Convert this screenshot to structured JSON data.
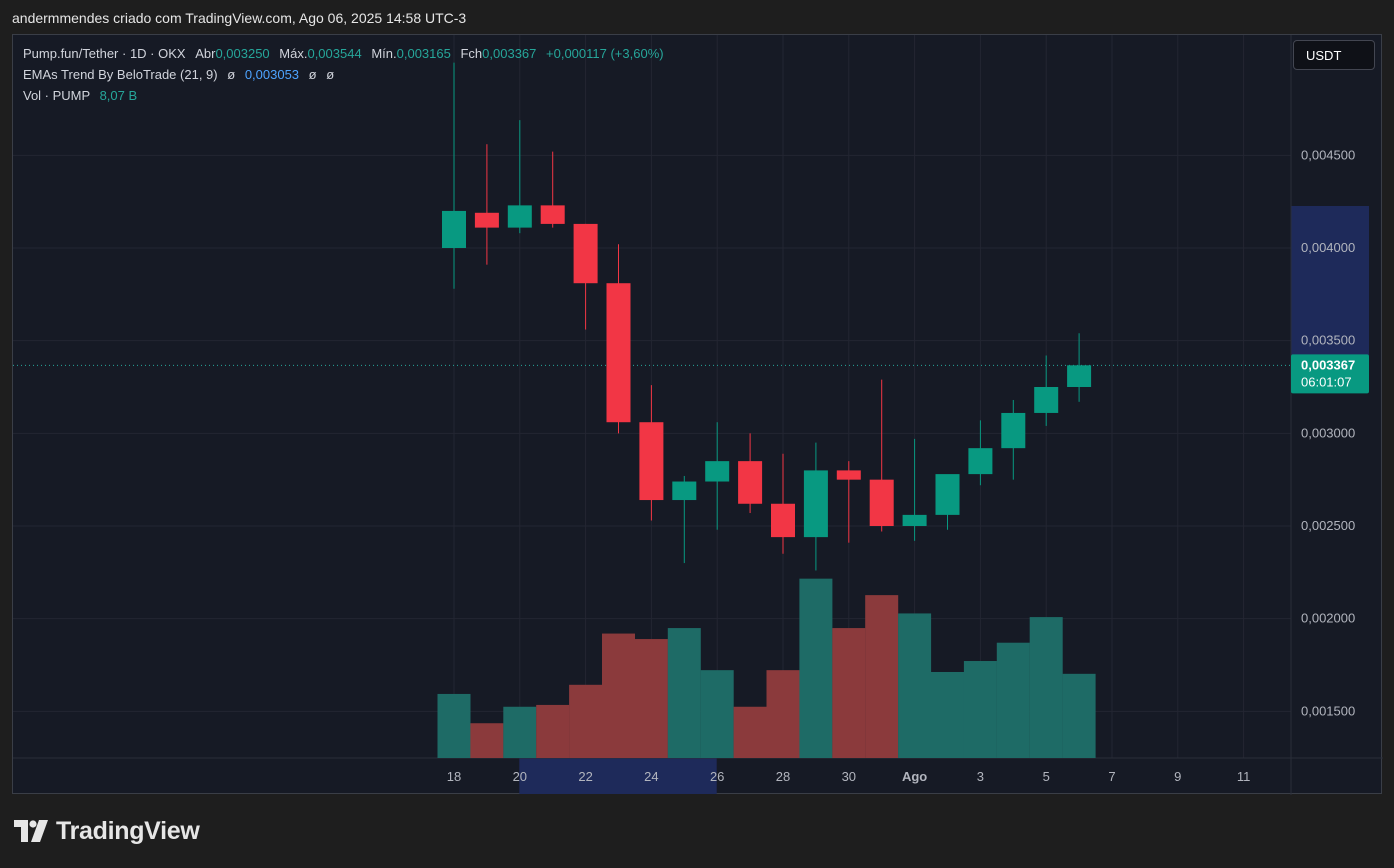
{
  "header": {
    "text": "andermmendes criado com TradingView.com, Ago 06, 2025 14:58 UTC-3"
  },
  "legend": {
    "line1": {
      "symbol": "Pump.fun/Tether · 1D · OKX",
      "o_label": "Abr",
      "o": "0,003250",
      "h_label": "Máx.",
      "h": "0,003544",
      "l_label": "Mín.",
      "l": "0,003165",
      "c_label": "Fch",
      "c": "0,003367",
      "change": "+0,000117 (+3,60%)"
    },
    "line2": {
      "name": "EMAs Trend By BeloTrade (21, 9)",
      "v1": "ø",
      "v2": "0,003053",
      "v3": "ø",
      "v4": "ø"
    },
    "line3": {
      "name": "Vol · PUMP",
      "value": "8,07 B"
    }
  },
  "currency_button": "USDT",
  "footer": {
    "brand": "TradingView"
  },
  "colors": {
    "up": "#089981",
    "down": "#f23645",
    "vol_up": "#1e6b66",
    "vol_down": "#8b3a3c",
    "grid": "#232632",
    "bg": "#161a25",
    "highlight": "#1e2a5a"
  },
  "chart_data": {
    "type": "candlestick",
    "price_axis": {
      "ticks": [
        "0,004500",
        "0,004000",
        "0,003500",
        "0,003000",
        "0,002500",
        "0,002000",
        "0,001500"
      ],
      "tick_values": [
        0.0045,
        0.004,
        0.0035,
        0.003,
        0.0025,
        0.002,
        0.0015
      ]
    },
    "time_axis": {
      "ticks": [
        "18",
        "20",
        "22",
        "24",
        "26",
        "28",
        "30",
        "Ago",
        "3",
        "5",
        "7",
        "9",
        "11"
      ]
    },
    "last_price": {
      "value": "0,003367",
      "countdown": "06:01:07",
      "numeric": 0.003367
    },
    "candles": [
      {
        "date": "Jul 18",
        "o": 0.004,
        "h": 0.005,
        "l": 0.00378,
        "c": 0.0042
      },
      {
        "date": "Jul 19",
        "o": 0.00419,
        "h": 0.00456,
        "l": 0.00391,
        "c": 0.00411
      },
      {
        "date": "Jul 20",
        "o": 0.00411,
        "h": 0.00469,
        "l": 0.00408,
        "c": 0.00423
      },
      {
        "date": "Jul 21",
        "o": 0.00423,
        "h": 0.00452,
        "l": 0.00411,
        "c": 0.00413
      },
      {
        "date": "Jul 22",
        "o": 0.00413,
        "h": 0.00413,
        "l": 0.00356,
        "c": 0.00381
      },
      {
        "date": "Jul 23",
        "o": 0.00381,
        "h": 0.00402,
        "l": 0.003,
        "c": 0.00306
      },
      {
        "date": "Jul 24",
        "o": 0.00306,
        "h": 0.00326,
        "l": 0.00253,
        "c": 0.00264
      },
      {
        "date": "Jul 25",
        "o": 0.00264,
        "h": 0.00277,
        "l": 0.0023,
        "c": 0.00274
      },
      {
        "date": "Jul 26",
        "o": 0.00274,
        "h": 0.00306,
        "l": 0.00248,
        "c": 0.00285
      },
      {
        "date": "Jul 27",
        "o": 0.00285,
        "h": 0.003,
        "l": 0.00257,
        "c": 0.00262
      },
      {
        "date": "Jul 28",
        "o": 0.00262,
        "h": 0.00289,
        "l": 0.00235,
        "c": 0.00244
      },
      {
        "date": "Jul 29",
        "o": 0.00244,
        "h": 0.00295,
        "l": 0.00226,
        "c": 0.0028
      },
      {
        "date": "Jul 30",
        "o": 0.0028,
        "h": 0.00285,
        "l": 0.00241,
        "c": 0.00275
      },
      {
        "date": "Jul 31",
        "o": 0.00275,
        "h": 0.00329,
        "l": 0.00247,
        "c": 0.0025
      },
      {
        "date": "Aug 1",
        "o": 0.0025,
        "h": 0.00297,
        "l": 0.00242,
        "c": 0.00256
      },
      {
        "date": "Aug 2",
        "o": 0.00256,
        "h": 0.00277,
        "l": 0.00248,
        "c": 0.00278
      },
      {
        "date": "Aug 3",
        "o": 0.00278,
        "h": 0.00307,
        "l": 0.00272,
        "c": 0.00292
      },
      {
        "date": "Aug 4",
        "o": 0.00292,
        "h": 0.00318,
        "l": 0.00275,
        "c": 0.00311
      },
      {
        "date": "Aug 5",
        "o": 0.00311,
        "h": 0.00342,
        "l": 0.00304,
        "c": 0.00325
      },
      {
        "date": "Aug 6",
        "o": 0.00325,
        "h": 0.00354,
        "l": 0.00317,
        "c": 0.003367
      }
    ],
    "volume_relative": [
      0.35,
      0.19,
      0.28,
      0.29,
      0.4,
      0.68,
      0.65,
      0.71,
      0.48,
      0.28,
      0.48,
      0.98,
      0.71,
      0.89,
      0.79,
      0.47,
      0.53,
      0.63,
      0.77,
      0.46
    ]
  }
}
